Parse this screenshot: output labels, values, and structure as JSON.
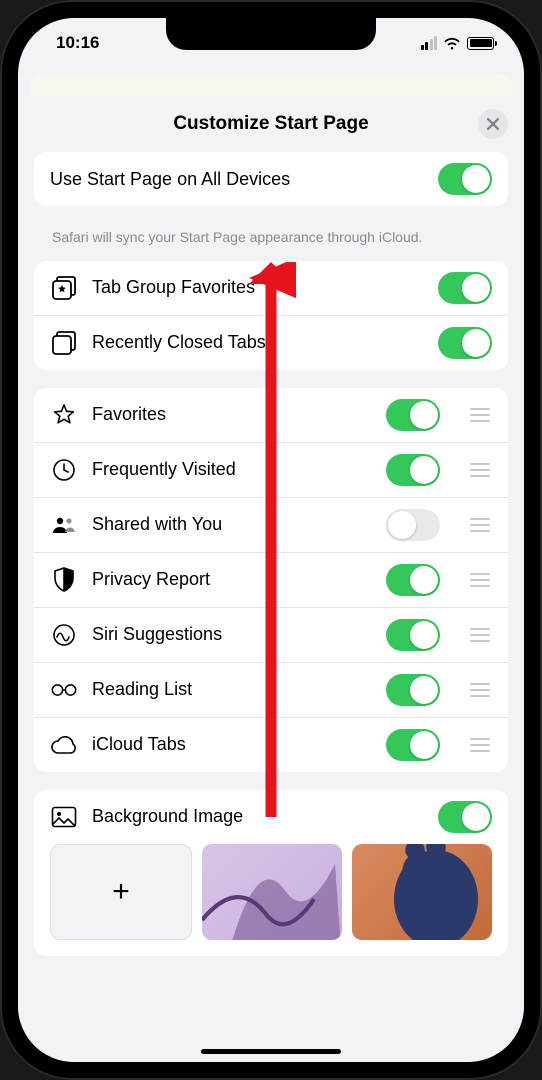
{
  "status": {
    "time": "10:16"
  },
  "sheet": {
    "title": "Customize Start Page"
  },
  "group1": {
    "row": {
      "label": "Use Start Page on All Devices",
      "on": true
    },
    "note": "Safari will sync your Start Page appearance through iCloud."
  },
  "group2": {
    "rows": [
      {
        "label": "Tab Group Favorites",
        "on": true
      },
      {
        "label": "Recently Closed Tabs",
        "on": true
      }
    ]
  },
  "group3": {
    "rows": [
      {
        "label": "Favorites",
        "on": true
      },
      {
        "label": "Frequently Visited",
        "on": true
      },
      {
        "label": "Shared with You",
        "on": false
      },
      {
        "label": "Privacy Report",
        "on": true
      },
      {
        "label": "Siri Suggestions",
        "on": true
      },
      {
        "label": "Reading List",
        "on": true
      },
      {
        "label": "iCloud Tabs",
        "on": true
      }
    ]
  },
  "group4": {
    "row": {
      "label": "Background Image",
      "on": true
    }
  }
}
